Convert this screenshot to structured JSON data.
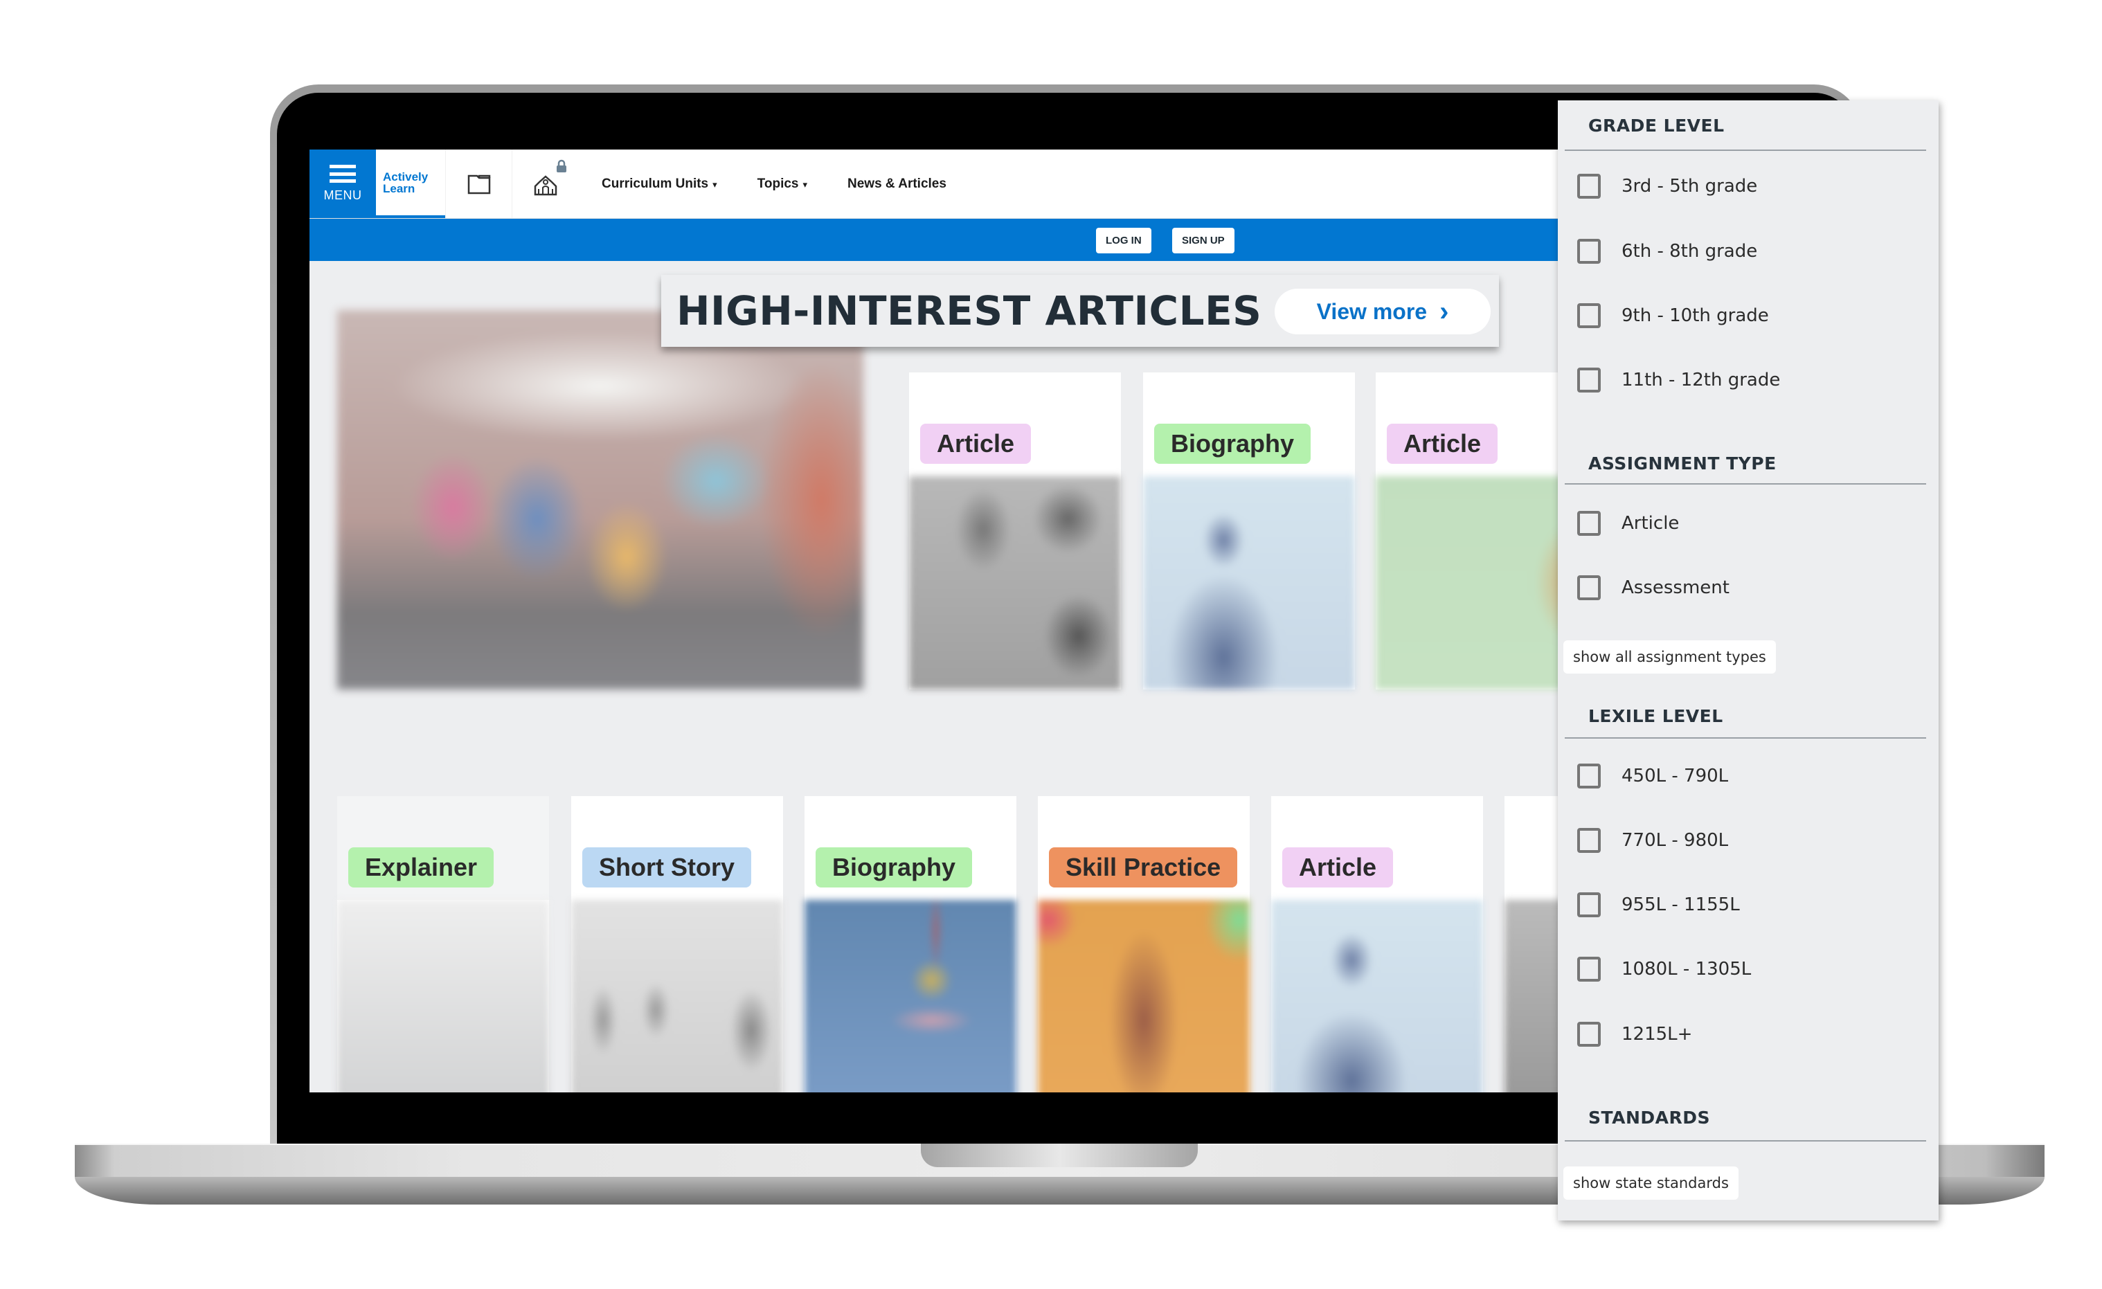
{
  "nav": {
    "menu_label": "MENU",
    "logo_line1": "Actively",
    "logo_line2": "Learn",
    "links": [
      {
        "label": "Curriculum Units",
        "caret": "▾"
      },
      {
        "label": "Topics",
        "caret": "▾"
      },
      {
        "label": "News & Articles"
      }
    ],
    "icons": [
      "folder-icon",
      "school-icon",
      "lock-icon"
    ]
  },
  "auth": {
    "login_label": "LOG IN",
    "signup_label": "SIGN UP"
  },
  "colors": {
    "brand_blue": "#0277d1",
    "badge_article": "#f1d0f4",
    "badge_biography": "#b4f1ad",
    "badge_explainer": "#b4f1ad",
    "badge_short_story": "#bbd8f3",
    "badge_skill_practice": "#ee925f"
  },
  "banner": {
    "title": "HIGH-INTEREST ARTICLES",
    "view_more_label": "View more",
    "view_more_icon": "›"
  },
  "cards_row1": [
    {
      "badge": "Article"
    },
    {
      "badge": "Biography"
    },
    {
      "badge": "Article"
    }
  ],
  "cards_row2": [
    {
      "badge": "Explainer"
    },
    {
      "badge": "Short Story"
    },
    {
      "badge": "Biography"
    },
    {
      "badge": "Skill Practice"
    },
    {
      "badge": "Article"
    }
  ],
  "filters": {
    "grade_level": {
      "title": "GRADE LEVEL",
      "options": [
        "3rd - 5th grade",
        "6th - 8th grade",
        "9th - 10th grade",
        "11th - 12th grade"
      ]
    },
    "assignment_type": {
      "title": "ASSIGNMENT TYPE",
      "options": [
        "Article",
        "Assessment"
      ],
      "show_all_label": "show all assignment types"
    },
    "lexile_level": {
      "title": "LEXILE LEVEL",
      "options": [
        "450L - 790L",
        "770L - 980L",
        "955L - 1155L",
        "1080L - 1305L",
        "1215L+"
      ]
    },
    "standards": {
      "title": "STANDARDS",
      "show_label": "show state standards"
    }
  }
}
